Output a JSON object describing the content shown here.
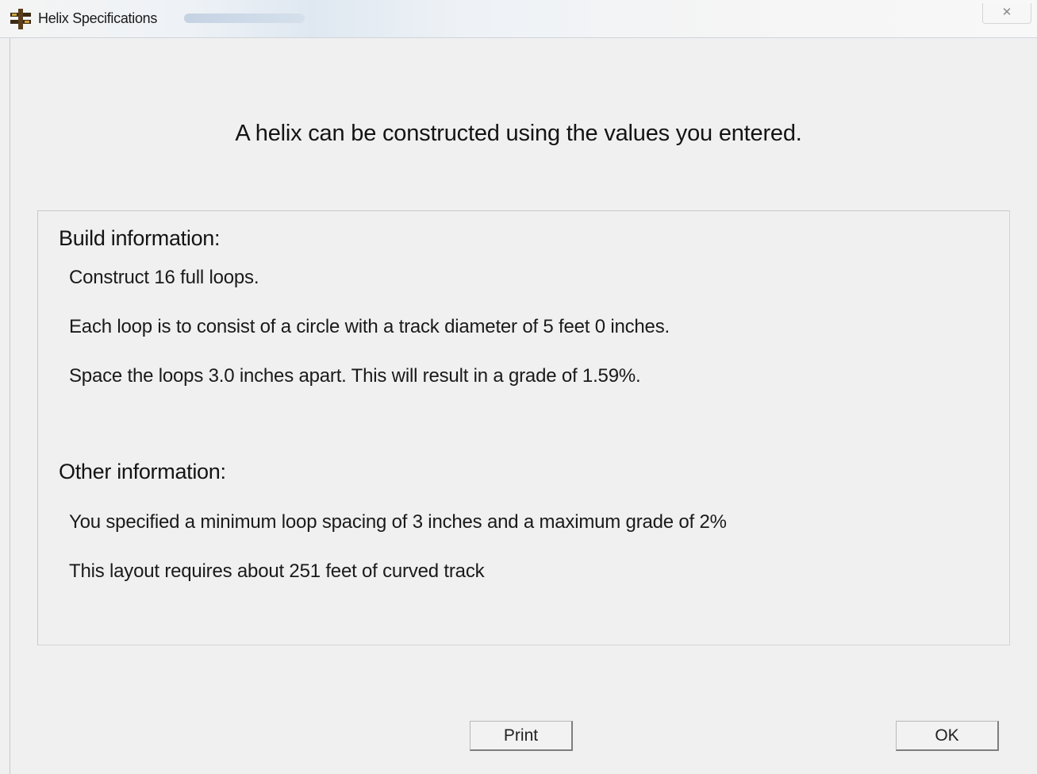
{
  "window": {
    "title": "Helix Specifications",
    "close_glyph": "✕",
    "icon": "helix-app-icon"
  },
  "headline": "A helix can be constructed using the values you entered.",
  "build": {
    "heading": "Build information:",
    "lines": [
      "Construct 16 full loops.",
      "Each loop is to consist of a circle with a track diameter of 5 feet 0 inches.",
      "Space the loops 3.0 inches apart. This will result in a grade of 1.59%."
    ]
  },
  "other": {
    "heading": "Other information:",
    "lines": [
      "You specified a minimum loop spacing of 3 inches and a maximum grade of 2%",
      "This layout requires about 251 feet of curved track"
    ]
  },
  "buttons": {
    "print_label": "Print",
    "ok_label": "OK"
  }
}
